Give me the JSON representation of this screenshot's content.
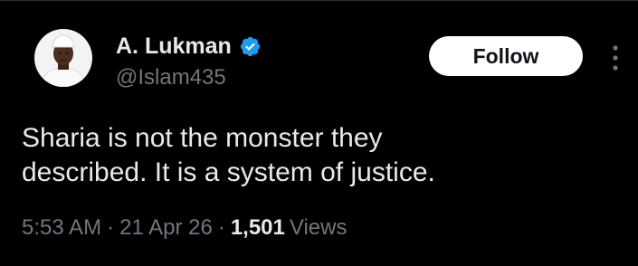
{
  "tweet": {
    "author": {
      "display_name": "A. Lukman",
      "handle": "@Islam435",
      "verified": true,
      "avatar_icon": "profile-photo"
    },
    "follow_label": "Follow",
    "more_icon": "more-vertical-icon",
    "text": "Sharia is not the monster they\ndescribed. It is a system of justice.",
    "time": "5:53 AM",
    "date": "21 Apr 26",
    "separator": "·",
    "views_count": "1,501",
    "views_label": "Views"
  },
  "colors": {
    "background": "#000000",
    "primary_text": "#e7e9ea",
    "secondary_text": "#71767b",
    "verified_badge": "#1d9bf0",
    "follow_bg": "#ffffff",
    "follow_text": "#0f1419"
  }
}
